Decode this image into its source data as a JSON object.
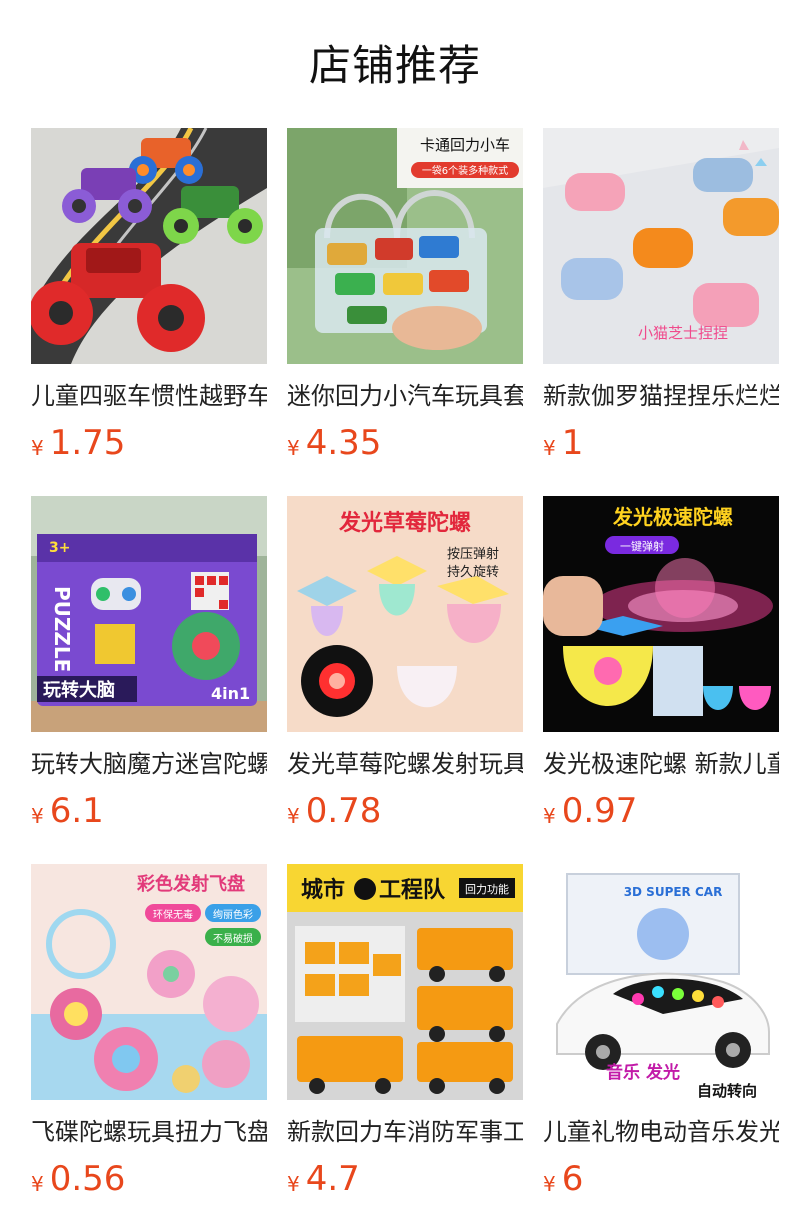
{
  "section": {
    "title": "店铺推荐"
  },
  "products": [
    {
      "name": "儿童四驱车惯性越野车",
      "currency": "¥",
      "price": "1.75",
      "image_text": []
    },
    {
      "name": "迷你回力小汽车玩具套装",
      "currency": "¥",
      "price": "4.35",
      "image_text": [
        "卡通回力小车",
        "一袋6个装多种款式"
      ]
    },
    {
      "name": "新款伽罗猫捏捏乐烂烂",
      "currency": "¥",
      "price": "1",
      "image_text": [
        "小猫芝士捏捏"
      ]
    },
    {
      "name": "玩转大脑魔方迷宫陀螺",
      "currency": "¥",
      "price": "6.1",
      "image_text": [
        "PUZZLE",
        "玩转大脑",
        "4in1",
        "3+"
      ]
    },
    {
      "name": "发光草莓陀螺发射玩具",
      "currency": "¥",
      "price": "0.78",
      "image_text": [
        "发光草莓陀螺",
        "按压弹射",
        "持久旋转"
      ]
    },
    {
      "name": "发光极速陀螺 新款儿童",
      "currency": "¥",
      "price": "0.97",
      "image_text": [
        "发光极速陀螺",
        "一键弹射"
      ]
    },
    {
      "name": "飞碟陀螺玩具扭力飞盘",
      "currency": "¥",
      "price": "0.56",
      "image_text": [
        "彩色发射飞盘",
        "环保无毒",
        "绚丽色彩",
        "不易破损"
      ]
    },
    {
      "name": "新款回力车消防军事工程",
      "currency": "¥",
      "price": "4.7",
      "image_text": [
        "城市",
        "工程队",
        "回力功能"
      ]
    },
    {
      "name": "儿童礼物电动音乐发光车",
      "currency": "¥",
      "price": "6",
      "image_text": [
        "3D SUPER CAR",
        "音乐 发光",
        "自动转向"
      ]
    }
  ]
}
